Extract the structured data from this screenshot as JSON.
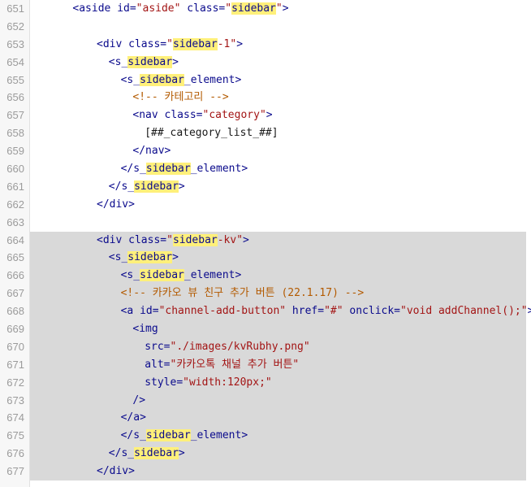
{
  "editor": {
    "lines": [
      {
        "n": "651",
        "indent": 3,
        "tokens": [
          {
            "t": "t",
            "v": "<aside "
          },
          {
            "t": "t",
            "v": "id="
          },
          {
            "t": "s",
            "v": "\"aside\""
          },
          {
            "t": "t",
            "v": " class="
          },
          {
            "t": "s",
            "v": "\""
          },
          {
            "t": "m",
            "v": "sidebar"
          },
          {
            "t": "s",
            "v": "\""
          },
          {
            "t": "t",
            "v": ">"
          }
        ]
      },
      {
        "n": "652",
        "indent": 0,
        "tokens": []
      },
      {
        "n": "653",
        "indent": 5,
        "tokens": [
          {
            "t": "t",
            "v": "<div "
          },
          {
            "t": "t",
            "v": "class="
          },
          {
            "t": "s",
            "v": "\""
          },
          {
            "t": "m",
            "v": "sidebar"
          },
          {
            "t": "s",
            "v": "-1\""
          },
          {
            "t": "t",
            "v": ">"
          }
        ]
      },
      {
        "n": "654",
        "indent": 6,
        "tokens": [
          {
            "t": "t",
            "v": "<s_"
          },
          {
            "t": "m",
            "v": "sidebar"
          },
          {
            "t": "t",
            "v": ">"
          }
        ]
      },
      {
        "n": "655",
        "indent": 7,
        "tokens": [
          {
            "t": "t",
            "v": "<s_"
          },
          {
            "t": "m",
            "v": "sidebar"
          },
          {
            "t": "t",
            "v": "_element>"
          }
        ]
      },
      {
        "n": "656",
        "indent": 8,
        "tokens": [
          {
            "t": "c",
            "v": "<!-- 카테고리 -->"
          }
        ]
      },
      {
        "n": "657",
        "indent": 8,
        "tokens": [
          {
            "t": "t",
            "v": "<nav "
          },
          {
            "t": "t",
            "v": "class="
          },
          {
            "t": "s",
            "v": "\"category\""
          },
          {
            "t": "t",
            "v": ">"
          }
        ]
      },
      {
        "n": "658",
        "indent": 9,
        "tokens": [
          {
            "t": "p",
            "v": "[##_category_list_##]"
          }
        ]
      },
      {
        "n": "659",
        "indent": 8,
        "tokens": [
          {
            "t": "t",
            "v": "</nav>"
          }
        ]
      },
      {
        "n": "660",
        "indent": 7,
        "tokens": [
          {
            "t": "t",
            "v": "</s_"
          },
          {
            "t": "m",
            "v": "sidebar"
          },
          {
            "t": "t",
            "v": "_element>"
          }
        ]
      },
      {
        "n": "661",
        "indent": 6,
        "tokens": [
          {
            "t": "t",
            "v": "</s_"
          },
          {
            "t": "m",
            "v": "sidebar"
          },
          {
            "t": "t",
            "v": ">"
          }
        ]
      },
      {
        "n": "662",
        "indent": 5,
        "tokens": [
          {
            "t": "t",
            "v": "</div>"
          }
        ]
      },
      {
        "n": "663",
        "indent": 0,
        "tokens": []
      },
      {
        "n": "664",
        "indent": 5,
        "hl": true,
        "tokens": [
          {
            "t": "t",
            "v": "<div "
          },
          {
            "t": "t",
            "v": "class="
          },
          {
            "t": "s",
            "v": "\""
          },
          {
            "t": "m",
            "v": "sidebar"
          },
          {
            "t": "s",
            "v": "-kv\""
          },
          {
            "t": "t",
            "v": ">"
          }
        ]
      },
      {
        "n": "665",
        "indent": 6,
        "hl": true,
        "tokens": [
          {
            "t": "t",
            "v": "<s_"
          },
          {
            "t": "m",
            "v": "sidebar"
          },
          {
            "t": "t",
            "v": ">"
          }
        ]
      },
      {
        "n": "666",
        "indent": 7,
        "hl": true,
        "tokens": [
          {
            "t": "t",
            "v": "<s_"
          },
          {
            "t": "m",
            "v": "sidebar"
          },
          {
            "t": "t",
            "v": "_element>"
          }
        ]
      },
      {
        "n": "667",
        "indent": 7,
        "hl": true,
        "tokens": [
          {
            "t": "c",
            "v": "<!-- 카카오 뷰 친구 추가 버튼 (22.1.17) -->"
          }
        ]
      },
      {
        "n": "668",
        "indent": 7,
        "hl": true,
        "tokens": [
          {
            "t": "t",
            "v": "<a "
          },
          {
            "t": "t",
            "v": "id="
          },
          {
            "t": "s",
            "v": "\"channel-add-button\""
          },
          {
            "t": "t",
            "v": " href="
          },
          {
            "t": "s",
            "v": "\"#\""
          },
          {
            "t": "t",
            "v": " onclick="
          },
          {
            "t": "s",
            "v": "\"void addChannel();\""
          },
          {
            "t": "t",
            "v": ">"
          }
        ]
      },
      {
        "n": "669",
        "indent": 8,
        "hl": true,
        "tokens": [
          {
            "t": "t",
            "v": "<img"
          }
        ]
      },
      {
        "n": "670",
        "indent": 9,
        "hl": true,
        "tokens": [
          {
            "t": "t",
            "v": "src="
          },
          {
            "t": "s",
            "v": "\"./images/kvRubhy.png\""
          }
        ]
      },
      {
        "n": "671",
        "indent": 9,
        "hl": true,
        "tokens": [
          {
            "t": "t",
            "v": "alt="
          },
          {
            "t": "s",
            "v": "\"카카오톡 채널 추가 버튼\""
          }
        ]
      },
      {
        "n": "672",
        "indent": 9,
        "hl": true,
        "tokens": [
          {
            "t": "t",
            "v": "style="
          },
          {
            "t": "s",
            "v": "\"width:120px;\""
          }
        ]
      },
      {
        "n": "673",
        "indent": 8,
        "hl": true,
        "tokens": [
          {
            "t": "t",
            "v": "/>"
          }
        ]
      },
      {
        "n": "674",
        "indent": 7,
        "hl": true,
        "tokens": [
          {
            "t": "t",
            "v": "</a>"
          }
        ]
      },
      {
        "n": "675",
        "indent": 7,
        "hl": true,
        "tokens": [
          {
            "t": "t",
            "v": "</s_"
          },
          {
            "t": "m",
            "v": "sidebar"
          },
          {
            "t": "t",
            "v": "_element>"
          }
        ]
      },
      {
        "n": "676",
        "indent": 6,
        "hl": true,
        "tokens": [
          {
            "t": "t",
            "v": "</s_"
          },
          {
            "t": "m",
            "v": "sidebar"
          },
          {
            "t": "t",
            "v": ">"
          }
        ]
      },
      {
        "n": "677",
        "indent": 5,
        "hl": true,
        "tokens": [
          {
            "t": "t",
            "v": "</div>"
          }
        ]
      }
    ]
  }
}
